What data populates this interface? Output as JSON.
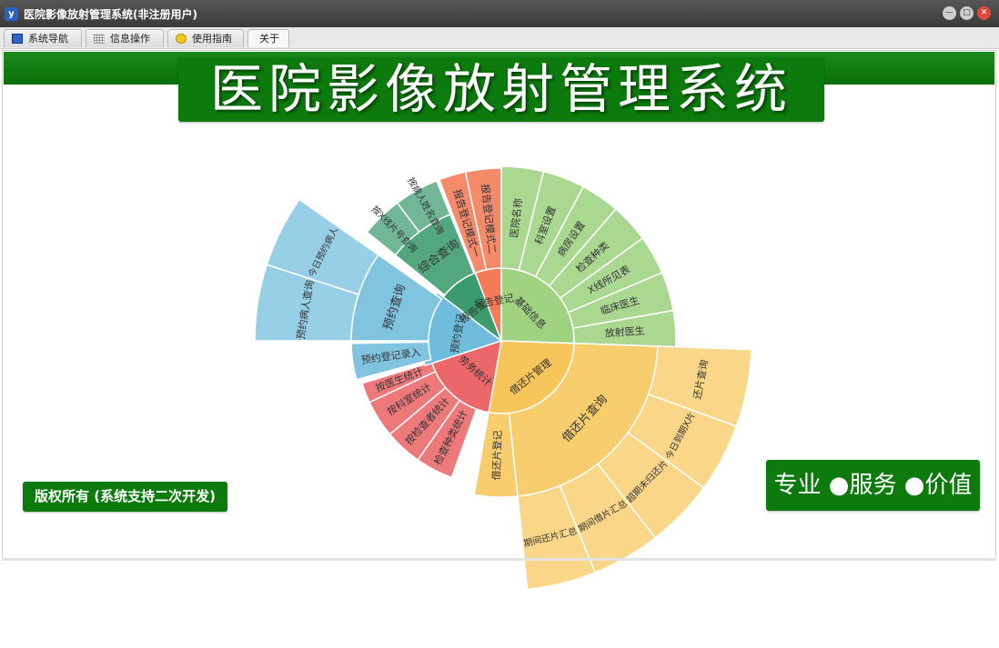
{
  "window": {
    "title": "医院影像放射管理系统(非注册用户)",
    "app_icon": "y",
    "minimize_glyph": "—",
    "maximize_glyph": "□",
    "close_glyph": "✕"
  },
  "tabs": [
    {
      "label": "系统导航",
      "icon": "monitor-icon"
    },
    {
      "label": "信息操作",
      "icon": "grid-icon"
    },
    {
      "label": "使用指南",
      "icon": "help-icon"
    },
    {
      "label": "关于",
      "icon": ""
    }
  ],
  "banner": {
    "title": "医院影像放射管理系统"
  },
  "copyright": "版权所有 (系统支持二次开发)",
  "slogan": "专业 ●服务 ●价值",
  "colors": {
    "brand_green": "#0c7a0c",
    "basic_info": "#a6d78d",
    "borrow": "#f9ce74",
    "stats": "#ef6e70",
    "appointment": "#78c0de",
    "report_query": "#4ea97f",
    "report_register": "#f58b6a"
  },
  "sunburst": {
    "categories": [
      {
        "key": "basic",
        "label": "基础信息",
        "color": "#9fd381",
        "children": [
          "医院名称",
          "科室设置",
          "病房设置",
          "检查种类",
          "X线所见表",
          "临床医生",
          "放射医生"
        ]
      },
      {
        "key": "borrow",
        "label": "借还片管理",
        "color": "#f6c65a",
        "children": [
          "借还片查询",
          "借还片登记"
        ],
        "grandchildren": [
          "还片查询",
          "今日到期X片",
          "超期未归还片",
          "期间借片汇总",
          "期间还片汇总"
        ]
      },
      {
        "key": "stats",
        "label": "劳务统计",
        "color": "#ec6769",
        "children": [
          "检查种类统计",
          "按检查者统计",
          "按科室统计",
          "按医生统计"
        ]
      },
      {
        "key": "appointment",
        "label": "预约登记",
        "color": "#6fbcdc",
        "children": [
          "预约登记录入",
          "预约查询"
        ],
        "grandchildren": [
          "预约病人查询",
          "今日预约病人"
        ]
      },
      {
        "key": "report_query",
        "label": "报告查询",
        "color": "#3a9b6e",
        "children": [
          "综合查询"
        ],
        "grandchildren": [
          "按X线片号查询",
          "按病人姓名查询"
        ]
      },
      {
        "key": "report_register",
        "label": "报告登记",
        "color": "#f47b57",
        "children": [
          "报告登记模式一",
          "报告登记模式二"
        ]
      }
    ]
  }
}
